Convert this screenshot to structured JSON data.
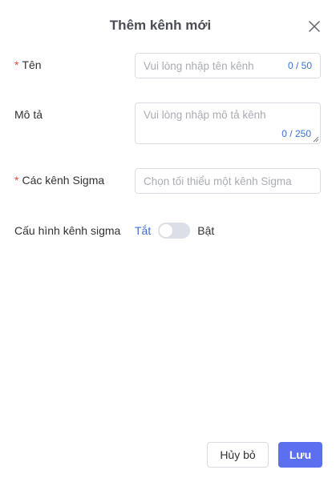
{
  "dialog": {
    "title": "Thêm kênh mới"
  },
  "form": {
    "name": {
      "required_mark": "*",
      "label": "Tên",
      "placeholder": "Vui lòng nhập tên kênh",
      "value": "",
      "counter": "0 / 50"
    },
    "description": {
      "label": "Mô tả",
      "placeholder": "Vui lòng nhập mô tả kênh",
      "value": "",
      "counter": "0 / 250"
    },
    "sigma_channels": {
      "required_mark": "*",
      "label": "Các kênh Sigma",
      "placeholder": "Chọn tối thiểu một kênh Sigma",
      "value": ""
    },
    "sigma_config": {
      "label": "Cấu hình kênh sigma",
      "off_label": "Tắt",
      "on_label": "Bật",
      "enabled": false
    }
  },
  "footer": {
    "cancel_label": "Hủy bỏ",
    "save_label": "Lưu"
  },
  "colors": {
    "primary": "#5b6ff0",
    "link_blue": "#3d6fd6",
    "required_red": "#e8423f",
    "switch_off": "#dcdfe6"
  },
  "icons": {
    "close": "close-icon"
  }
}
